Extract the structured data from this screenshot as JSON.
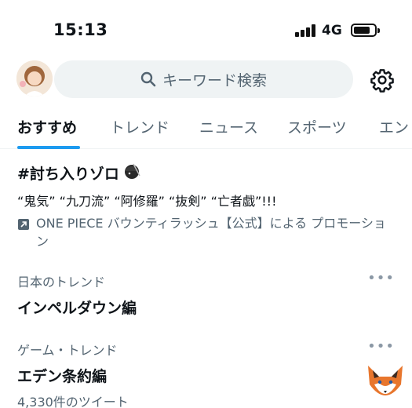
{
  "status_bar": {
    "time": "15:13",
    "network": "4G"
  },
  "header": {
    "search_placeholder": "キーワード検索"
  },
  "tabs": [
    "おすすめ",
    "トレンド",
    "ニュース",
    "スポーツ",
    "エン"
  ],
  "promoted": {
    "title": "#討ち入りゾロ",
    "subtitle": "“鬼気” “九刀流” “阿修羅” “抜剣” “亡者戯”!!!",
    "promotion": "ONE PIECE バウンティラッシュ【公式】による プロモーション"
  },
  "trends": [
    {
      "context": "日本のトレンド",
      "name": "インペルダウン編",
      "count": ""
    },
    {
      "context": "ゲーム・トレンド",
      "name": "エデン条約編",
      "count": "4,330件のツイート"
    }
  ],
  "colors": {
    "accent": "#1d9bf0",
    "muted": "#536471",
    "search_bg": "#eff3f4"
  },
  "icons": [
    "search-icon",
    "gear-icon",
    "promoted-arrow-icon",
    "more-icon"
  ]
}
